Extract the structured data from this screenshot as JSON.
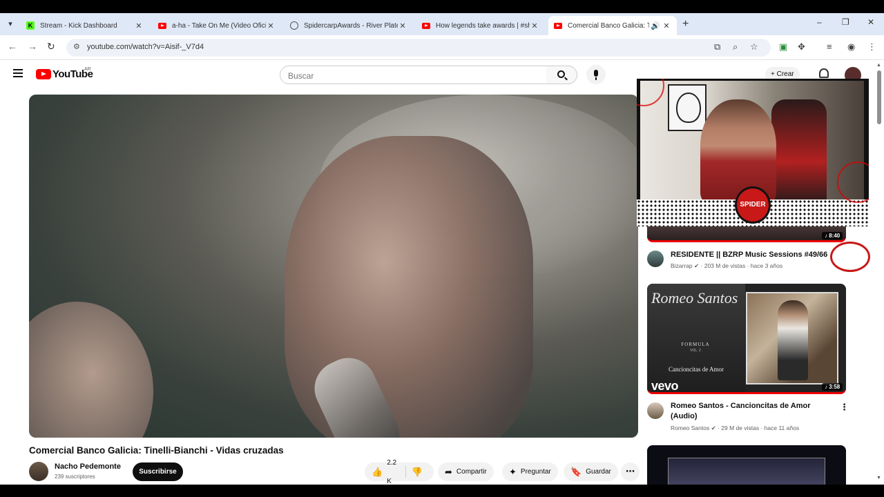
{
  "browser": {
    "tabs": [
      {
        "title": "Stream - Kick Dashboard",
        "favicon": "kick-icon",
        "active": false
      },
      {
        "title": "a-ha - Take On Me (Video Oficial)",
        "favicon": "youtube-icon",
        "active": false
      },
      {
        "title": "SpidercarpAwards - River Plate",
        "favicon": "globe-icon",
        "active": false
      },
      {
        "title": "How legends take awards | #shorts",
        "favicon": "youtube-icon",
        "active": false
      },
      {
        "title": "Comercial Banco Galicia: Tinelli-Bianchi",
        "favicon": "youtube-icon",
        "active": true
      }
    ],
    "new_tab_label": "+",
    "window_controls": [
      "–",
      "❐",
      "✕"
    ],
    "url": "youtube.com/watch?v=Aisif-_V7d4"
  },
  "youtube": {
    "logo_text": "YouTube",
    "country": "AR",
    "search_placeholder": "Buscar",
    "create_label": "Crear"
  },
  "video": {
    "title": "Comercial Banco Galicia: Tinelli-Bianchi - Vidas cruzadas",
    "channel": "Nacho Pedemonte",
    "subscribers": "239 suscriptores",
    "subscribe_label": "Suscribirse",
    "likes": "2.2 K",
    "share_label": "Compartir",
    "ask_label": "Preguntar",
    "save_label": "Guardar"
  },
  "recommendations": [
    {
      "title": "RESIDENTE || BZRP Music Sessions #49/66",
      "channel": "Bizarrap",
      "stats": "203 M de vistas · hace 3 años",
      "duration": "8:40"
    },
    {
      "title": "Romeo Santos - Cancioncitas de Amor (Audio)",
      "channel": "Romeo Santos",
      "stats": "29 M de vistas · hace 11 años",
      "duration": "3:58",
      "thumb_artist": "Romeo Santos",
      "thumb_series": "FORMULA",
      "thumb_volume": "VOL. 2",
      "thumb_album": "Cancioncitas de Amor",
      "thumb_brand": "vevo"
    }
  ],
  "overlay": {
    "badge_text": "SPIDER CARP"
  }
}
